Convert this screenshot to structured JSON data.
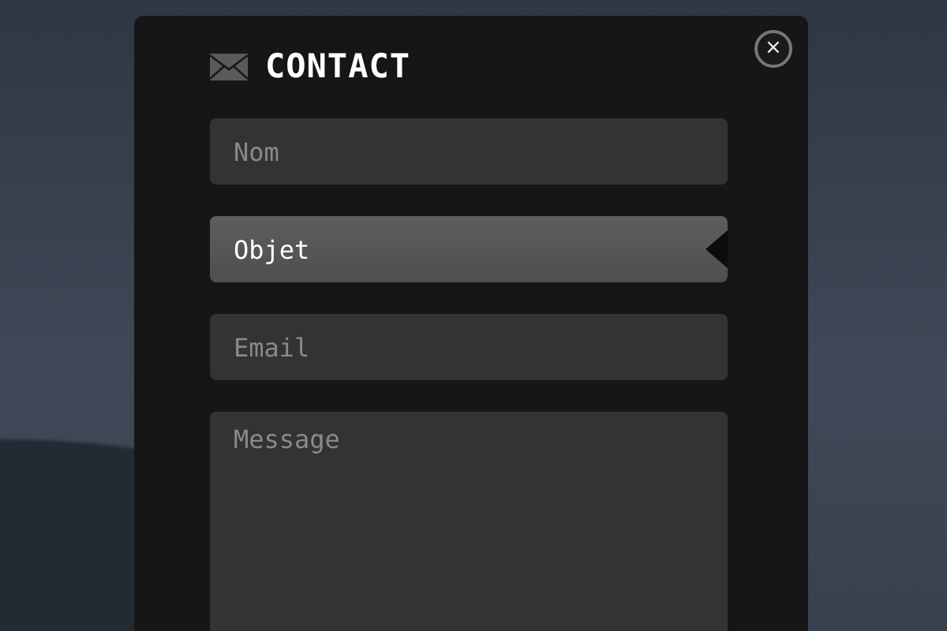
{
  "dialog": {
    "title": "CONTACT",
    "close_label": "×"
  },
  "fields": [
    {
      "kind": "input",
      "placeholder": "Nom",
      "focused": false
    },
    {
      "kind": "input",
      "placeholder": "Objet",
      "focused": true
    },
    {
      "kind": "input",
      "placeholder": "Email",
      "focused": false
    },
    {
      "kind": "textarea",
      "placeholder": "Message",
      "focused": false
    }
  ]
}
